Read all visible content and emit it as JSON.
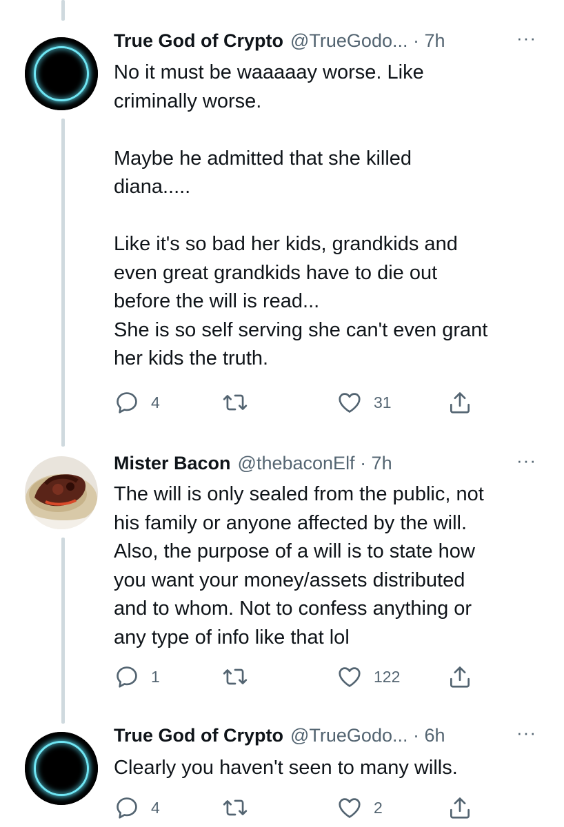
{
  "tweets": [
    {
      "name": "True God of Crypto",
      "handle": "@TrueGodo... · 7h",
      "more": "···",
      "avatar": "crypto-ring-avatar",
      "text": "No it must be waaaaay worse. Like\ncriminally worse.\n\nMaybe he admitted that she killed\ndiana.....\n\nLike it's so bad her kids, grandkids and\neven great grandkids have to die out\nbefore the will is read...\nShe is so self serving she can't even grant\nher kids the truth.",
      "replies": "4",
      "retweets": "",
      "likes": "31"
    },
    {
      "name": "Mister Bacon",
      "handle": "@thebaconElf · 7h",
      "more": "···",
      "avatar": "sandwich-avatar",
      "text": "The will is only sealed from the public, not\nhis family or anyone affected by the will.\nAlso, the purpose of a will is to state how\nyou want your money/assets distributed\nand to whom. Not to confess anything or\nany type of info like that lol",
      "replies": "1",
      "retweets": "",
      "likes": "122"
    },
    {
      "name": "True God of Crypto",
      "handle": "@TrueGodo... · 6h",
      "more": "···",
      "avatar": "crypto-ring-avatar",
      "text": "Clearly you haven't seen to many wills.",
      "replies": "4",
      "retweets": "",
      "likes": "2"
    }
  ],
  "icons": {
    "reply": "reply-icon",
    "retweet": "retweet-icon",
    "like": "like-icon",
    "share": "share-icon"
  },
  "colors": {
    "text": "#0f1419",
    "secondary": "#536471",
    "thread_line": "#cfd9de",
    "avatar_glow": "#6fe6f4"
  }
}
